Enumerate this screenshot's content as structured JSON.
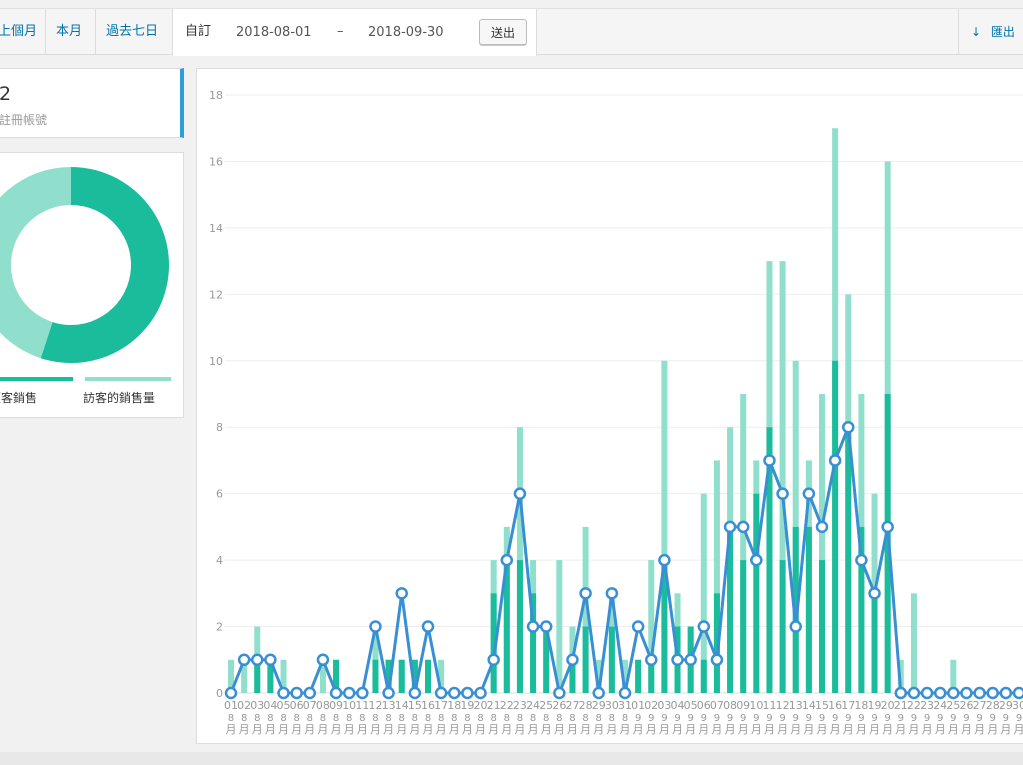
{
  "range_tabs": [
    "上個月",
    "本月",
    "過去七日"
  ],
  "custom": {
    "label": "自訂",
    "start": "2018-08-01",
    "dash": "–",
    "end": "2018-09-30",
    "go_label": "送出"
  },
  "export": {
    "icon": "download-arrow-icon",
    "label": "匯出"
  },
  "stat_card": {
    "value": "2",
    "label": "註冊帳號"
  },
  "donut": {
    "legend": [
      {
        "label": "顧客銷售",
        "color": "#1abc9c"
      },
      {
        "label": "訪客的銷售量",
        "color": "#8fdfcc"
      }
    ],
    "slices": [
      {
        "name": "顧客銷售",
        "fraction": 0.55,
        "color": "#1abc9c"
      },
      {
        "name": "訪客的銷售量",
        "fraction": 0.45,
        "color": "#8fdfcc"
      }
    ]
  },
  "chart_data": {
    "type": "bar",
    "ylim": [
      0,
      18
    ],
    "yticks": [
      0,
      2,
      4,
      6,
      8,
      10,
      12,
      14,
      16,
      18
    ],
    "grid": true,
    "x_days": [
      "01",
      "02",
      "03",
      "04",
      "05",
      "06",
      "07",
      "08",
      "09",
      "10",
      "11",
      "12",
      "13",
      "14",
      "15",
      "16",
      "17",
      "18",
      "19",
      "20",
      "21",
      "22",
      "23",
      "24",
      "25",
      "26",
      "27",
      "28",
      "29",
      "30",
      "31",
      "01",
      "02",
      "03",
      "04",
      "05",
      "06",
      "07",
      "08",
      "09",
      "10",
      "11",
      "12",
      "13",
      "14",
      "15",
      "16",
      "17",
      "18",
      "19",
      "20",
      "21",
      "22",
      "23",
      "24",
      "25",
      "26",
      "27",
      "28",
      "29",
      "30"
    ],
    "x_months": [
      "8",
      "8",
      "8",
      "8",
      "8",
      "8",
      "8",
      "8",
      "8",
      "8",
      "8",
      "8",
      "8",
      "8",
      "8",
      "8",
      "8",
      "8",
      "8",
      "8",
      "8",
      "8",
      "8",
      "8",
      "8",
      "8",
      "8",
      "8",
      "8",
      "8",
      "8",
      "9",
      "9",
      "9",
      "9",
      "9",
      "9",
      "9",
      "9",
      "9",
      "9",
      "9",
      "9",
      "9",
      "9",
      "9",
      "9",
      "9",
      "9",
      "9",
      "9",
      "9",
      "9",
      "9",
      "9",
      "9",
      "9",
      "9",
      "9",
      "9",
      "9"
    ],
    "x_suffix": "月",
    "series": [
      {
        "kind": "bar",
        "color": "#1abc9c",
        "values": [
          0,
          0,
          1,
          1,
          0,
          0,
          0,
          0,
          1,
          0,
          0,
          1,
          1,
          1,
          1,
          1,
          0,
          0,
          0,
          0,
          3,
          4,
          4,
          3,
          2,
          0,
          1,
          2,
          0,
          2,
          0,
          1,
          1,
          4,
          2,
          2,
          1,
          3,
          5,
          4,
          6,
          8,
          4,
          5,
          5,
          4,
          10,
          8,
          5,
          3,
          9,
          0,
          0,
          0,
          0,
          0,
          0,
          0,
          0,
          0,
          0
        ]
      },
      {
        "kind": "bar",
        "color": "#8fdfcc",
        "values": [
          1,
          1,
          2,
          1,
          1,
          0,
          0,
          1,
          1,
          0,
          0,
          2,
          1,
          1,
          1,
          1,
          1,
          0,
          0,
          0,
          4,
          5,
          8,
          4,
          2,
          4,
          2,
          5,
          1,
          3,
          1,
          1,
          4,
          10,
          3,
          2,
          6,
          7,
          8,
          9,
          7,
          13,
          13,
          10,
          7,
          9,
          17,
          12,
          9,
          6,
          16,
          1,
          3,
          0,
          0,
          1,
          0,
          0,
          0,
          0,
          0
        ]
      },
      {
        "kind": "line",
        "color": "#3a8fd4",
        "values": [
          0,
          1,
          1,
          1,
          0,
          0,
          0,
          1,
          0,
          0,
          0,
          2,
          0,
          3,
          0,
          2,
          0,
          0,
          0,
          0,
          1,
          4,
          6,
          2,
          2,
          0,
          1,
          3,
          0,
          3,
          0,
          2,
          1,
          4,
          1,
          1,
          2,
          1,
          5,
          5,
          4,
          7,
          6,
          2,
          6,
          5,
          7,
          8,
          4,
          3,
          5,
          0,
          0,
          0,
          0,
          0,
          0,
          0,
          0,
          0,
          0
        ]
      }
    ]
  }
}
